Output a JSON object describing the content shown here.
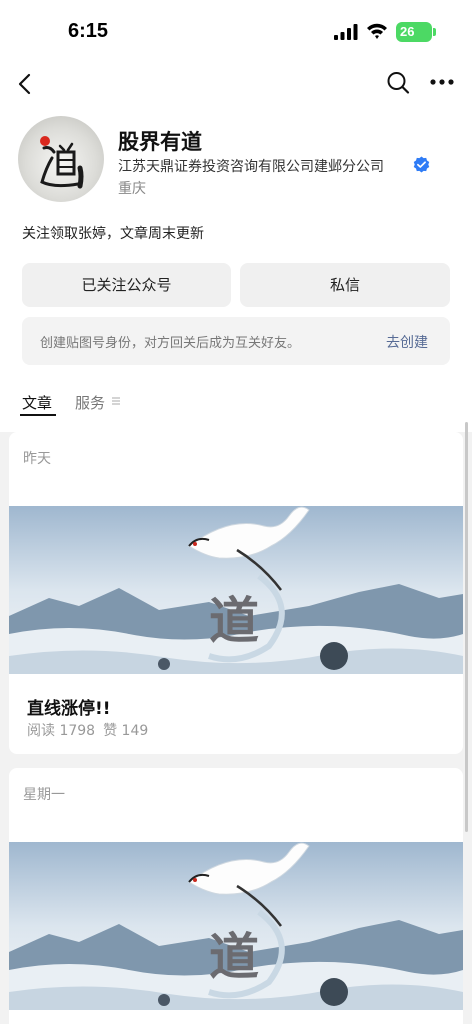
{
  "status_bar": {
    "time": "6:15",
    "battery": "26"
  },
  "profile": {
    "name": "股界有道",
    "company": "江苏天鼎证券投资咨询有限公司建邺分公司",
    "location": "重庆",
    "bio": "关注领取张婷，文章周末更新"
  },
  "actions": {
    "follow_label": "已关注公众号",
    "message_label": "私信"
  },
  "invite": {
    "text": "创建贴图号身份，对方回关后成为互关好友。",
    "link_label": "去创建"
  },
  "tabs": [
    {
      "label": "文章",
      "active": true
    },
    {
      "label": "服务",
      "active": false
    }
  ],
  "articles": [
    {
      "date": "昨天",
      "title": "直线涨停!!",
      "reads": "阅读 1798",
      "likes": "赞 149",
      "cover_char": "道"
    },
    {
      "date": "星期一",
      "cover_char": "道"
    }
  ],
  "colors": {
    "link": "#576b95",
    "verified": "#2f7cf6",
    "battery": "#4cd964"
  }
}
